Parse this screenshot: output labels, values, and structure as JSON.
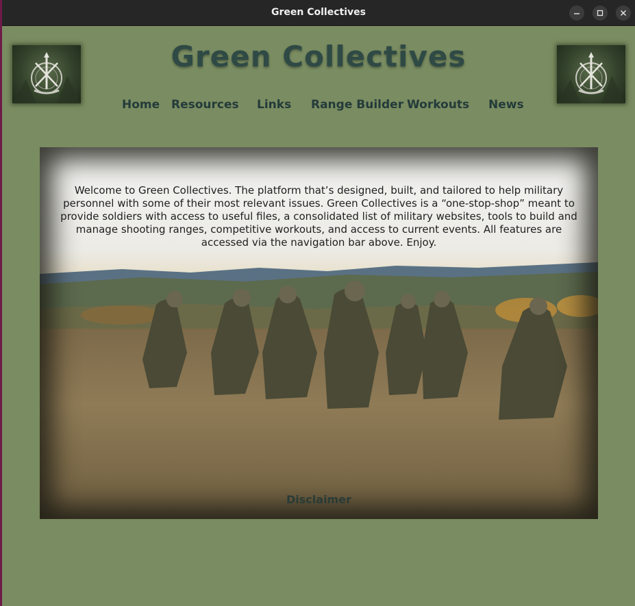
{
  "window": {
    "title": "Green Collectives",
    "controls": [
      "minimize-icon",
      "maximize-icon",
      "close-icon"
    ]
  },
  "header": {
    "site_title": "Green Collectives",
    "logo_icon": "special-forces-crest-icon"
  },
  "nav": {
    "items": [
      {
        "label": "Home"
      },
      {
        "label": "Resources"
      },
      {
        "label": "Links"
      },
      {
        "label": "Range Builder"
      },
      {
        "label": "Workouts"
      },
      {
        "label": "News"
      }
    ]
  },
  "hero": {
    "welcome_text": "Welcome to Green Collectives. The platform that’s designed, built, and tailored to help military personnel with some of their most relevant issues. Green Collectives is a “one-stop-shop” meant to provide soldiers with access to useful files, a consolidated list of military websites, tools to build and manage shooting ranges, competitive workouts, and access to current events. All features are accessed via the navigation bar above. Enjoy.",
    "disclaimer_label": "Disclaimer"
  },
  "colors": {
    "page_background": "#7a8c61",
    "title_text": "#2f4a45",
    "nav_text": "#243b3a",
    "titlebar": "#262626"
  }
}
